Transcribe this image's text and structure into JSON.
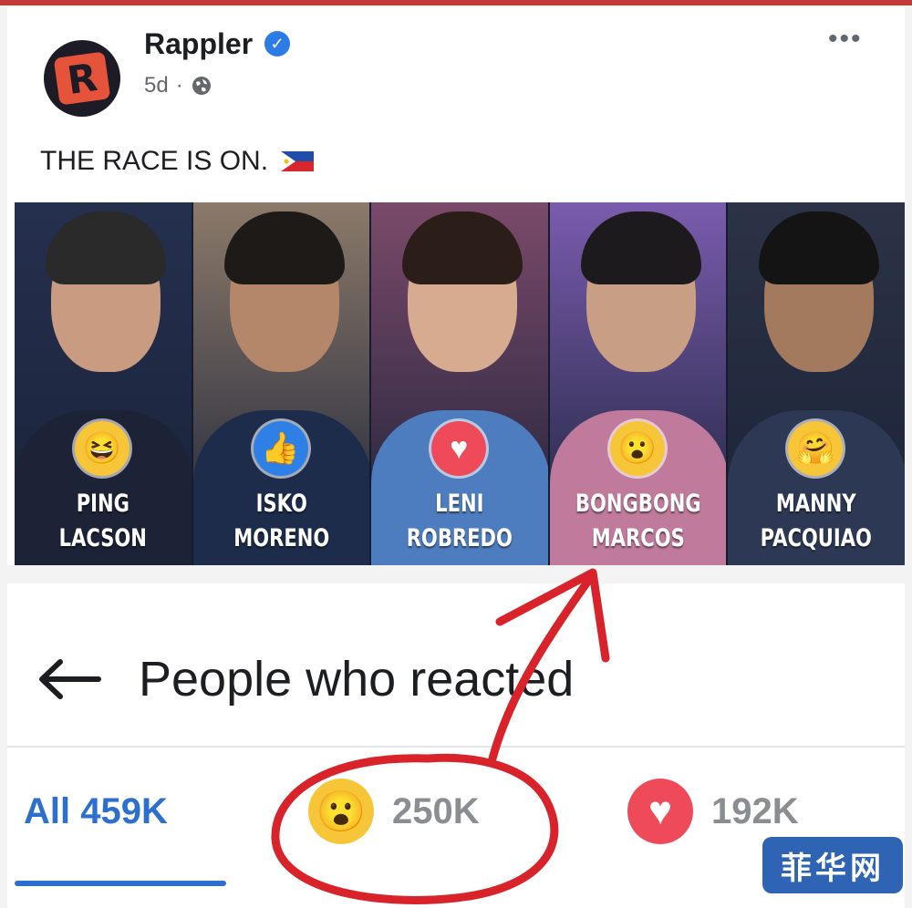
{
  "post": {
    "page_name": "Rappler",
    "time": "5d",
    "separator": "·",
    "text": "THE RACE IS ON.",
    "more_label": "•••",
    "avatar_letter": "R",
    "verified_glyph": "✓"
  },
  "banner": {
    "candidates": [
      {
        "line1": "PING",
        "line2": "LACSON",
        "reaction": "haha",
        "emoji": "😆",
        "emoji_bg": "#f7c638",
        "bg": "#25304f",
        "skin": "#c99b80",
        "hair": "#2a2a2a",
        "suit": "#1c2336"
      },
      {
        "line1": "ISKO",
        "line2": "MORENO",
        "reaction": "like",
        "emoji": "👍",
        "emoji_bg": "#2e7fe6",
        "bg": "#8c7a6a",
        "skin": "#b4876b",
        "hair": "#1e1a18",
        "suit": "#1d2c4a"
      },
      {
        "line1": "LENI",
        "line2": "ROBREDO",
        "reaction": "love",
        "emoji": "♥",
        "emoji_bg": "#ee4a5a",
        "bg": "#7b4a6a",
        "skin": "#d7ab90",
        "hair": "#2b1d18",
        "suit": "#4e7dbf"
      },
      {
        "line1": "BONGBONG",
        "line2": "MARCOS",
        "reaction": "wow",
        "emoji": "😮",
        "emoji_bg": "#f7c638",
        "bg": "#7a5cae",
        "skin": "#c89e84",
        "hair": "#1c1a1c",
        "suit": "#c07a9c"
      },
      {
        "line1": "MANNY",
        "line2": "PACQUIAO",
        "reaction": "care",
        "emoji": "🤗",
        "emoji_bg": "#f7c638",
        "bg": "#2c3346",
        "skin": "#a47a5e",
        "hair": "#141414",
        "suit": "#2d3954"
      }
    ]
  },
  "reactions_sheet": {
    "title": "People who reacted",
    "tabs": {
      "all": "All 459K",
      "wow_count": "250K",
      "love_count": "192K"
    }
  },
  "watermark": "菲华网",
  "colors": {
    "accent_blue": "#2d6fcf",
    "annotation_red": "#d9232a"
  }
}
